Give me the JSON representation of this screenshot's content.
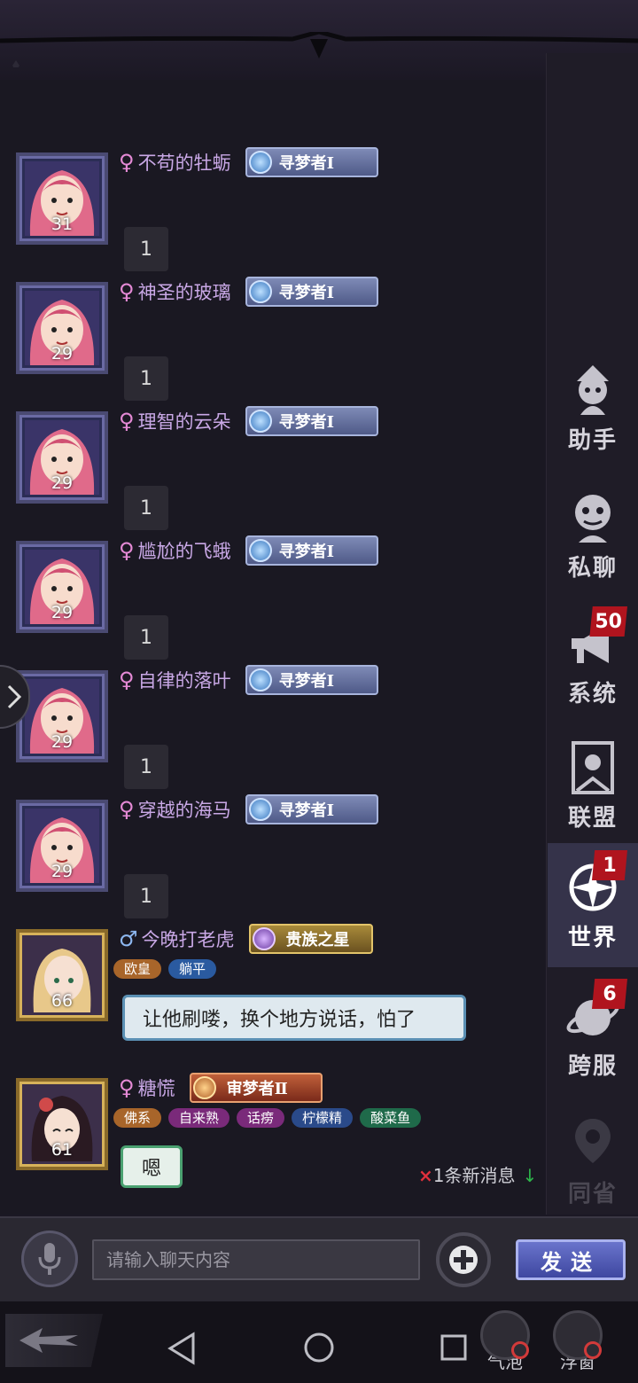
{
  "sidebar": {
    "items": [
      {
        "label": "助手",
        "icon": "assistant-icon"
      },
      {
        "label": "私聊",
        "icon": "private-chat-icon"
      },
      {
        "label": "系统",
        "icon": "megaphone-icon",
        "badge": "50"
      },
      {
        "label": "联盟",
        "icon": "alliance-banner-icon"
      },
      {
        "label": "世界",
        "icon": "world-compass-icon",
        "badge": "1",
        "active": true
      },
      {
        "label": "跨服",
        "icon": "cross-server-icon",
        "badge": "6"
      },
      {
        "label": "同省",
        "icon": "location-pin-icon",
        "disabled": true
      }
    ]
  },
  "messages": [
    {
      "gender": "♀",
      "name": "不苟的牡蛎",
      "rank": "寻梦者Ⅰ",
      "level": "31",
      "text": "1"
    },
    {
      "gender": "♀",
      "name": "神圣的玻璃",
      "rank": "寻梦者Ⅰ",
      "level": "29",
      "text": "1"
    },
    {
      "gender": "♀",
      "name": "理智的云朵",
      "rank": "寻梦者Ⅰ",
      "level": "29",
      "text": "1"
    },
    {
      "gender": "♀",
      "name": "尴尬的飞蛾",
      "rank": "寻梦者Ⅰ",
      "level": "29",
      "text": "1"
    },
    {
      "gender": "♀",
      "name": "自律的落叶",
      "rank": "寻梦者Ⅰ",
      "level": "29",
      "text": "1"
    },
    {
      "gender": "♀",
      "name": "穿越的海马",
      "rank": "寻梦者Ⅰ",
      "level": "29",
      "text": "1"
    },
    {
      "gender": "♂",
      "name": "今晚打老虎",
      "rank": "贵族之星",
      "level": "66",
      "tags": [
        "欧皇",
        "躺平"
      ],
      "text": "让他刷喽，换个地方说话，怕了"
    },
    {
      "gender": "♀",
      "name": "糖慌",
      "rank": "审梦者Ⅱ",
      "level": "61",
      "tags": [
        "佛系",
        "自来熟",
        "话痨",
        "柠檬精",
        "酸菜鱼"
      ],
      "text": "嗯"
    }
  ],
  "new_messages": {
    "prefix": "×",
    "text": "1条新消息",
    "arrow": "↓"
  },
  "input": {
    "placeholder": "请输入聊天内容",
    "send_label": "发送"
  },
  "nav": {
    "bubble_label": "气泡",
    "float_label": "浮窗"
  },
  "colors": {
    "background": "#1b1824",
    "name_female": "#c9a8e6",
    "badge_red": "#b0141e",
    "send_button": "#4a52b0"
  }
}
